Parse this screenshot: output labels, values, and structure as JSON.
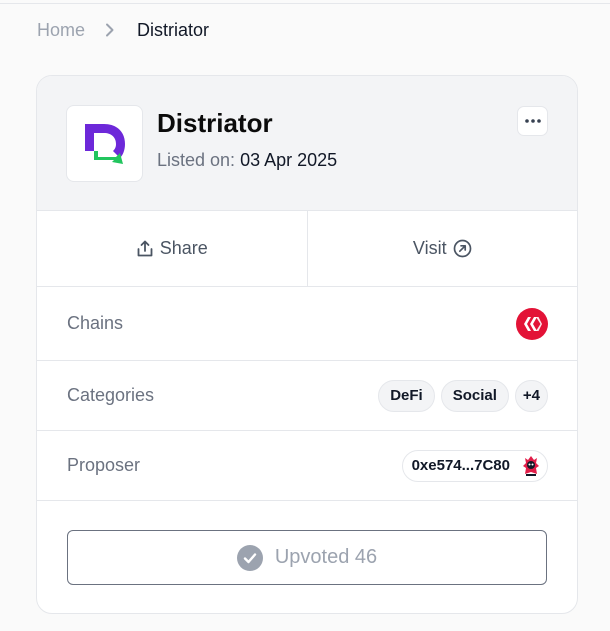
{
  "breadcrumb": {
    "home": "Home",
    "current": "Distriator"
  },
  "project": {
    "name": "Distriator",
    "listed_label": "Listed on:",
    "listed_date": "03 Apr 2025",
    "logo_icon": "distriator-logo",
    "more_icon": "ellipsis-icon"
  },
  "actions": {
    "share_label": "Share",
    "visit_label": "Visit"
  },
  "chains": {
    "label": "Chains",
    "items": [
      {
        "name": "hive-chain-icon",
        "color": "#e31337"
      }
    ]
  },
  "categories": {
    "label": "Categories",
    "tags": [
      "DeFi",
      "Social"
    ],
    "more": "+4"
  },
  "proposer": {
    "label": "Proposer",
    "address": "0xe574...7C80"
  },
  "upvote": {
    "label": "Upvoted 46"
  },
  "colors": {
    "accent_purple": "#6d28d9",
    "accent_green": "#22c55e",
    "hive_red": "#e31337"
  }
}
